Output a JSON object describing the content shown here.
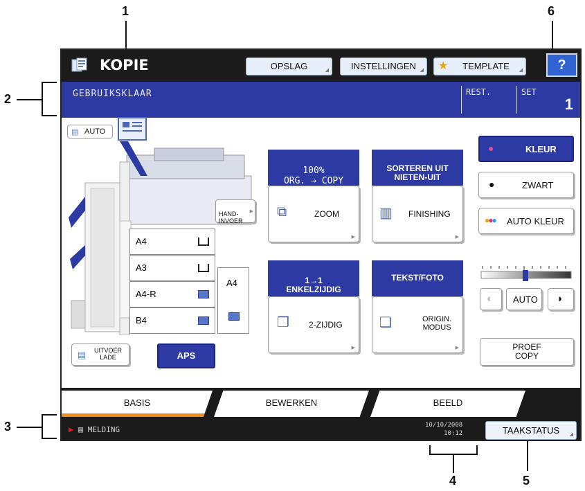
{
  "callouts": {
    "c1": "1",
    "c2": "2",
    "c3": "3",
    "c4": "4",
    "c5": "5",
    "c6": "6"
  },
  "titlebar": {
    "title": "KOPIE",
    "buttons": [
      "OPSLAG",
      "INSTELLINGEN",
      "TEMPLATE"
    ],
    "help": "?"
  },
  "status": {
    "message": "GEBRUIKSKLAAR",
    "rest_label": "REST.",
    "set_label": "SET",
    "set_count": "1"
  },
  "paper": {
    "auto_label": "AUTO",
    "manual_feed": "HAND-\nINVOER",
    "trays": [
      {
        "size": "A4",
        "icon": "open-tray-icon"
      },
      {
        "size": "A3",
        "icon": "open-tray-icon"
      },
      {
        "size": "A4-R",
        "icon": "paper-tray-icon"
      },
      {
        "size": "B4",
        "icon": "paper-tray-icon"
      }
    ],
    "bypass_size": "A4",
    "output_tray": "UITVOER\nLADE",
    "aps": "APS"
  },
  "functions": {
    "zoom_header": "100%\nORG. → COPY",
    "zoom": "ZOOM",
    "finishing_header": "SORTEREN UIT\nNIETEN-UIT",
    "finishing": "FINISHING",
    "duplex_header": "1→1\nENKELZIJDIG",
    "duplex": "2-ZIJDIG",
    "original_header": "TEKST/FOTO",
    "original": "ORIGIN.\nMODUS"
  },
  "color": {
    "kleur": "KLEUR",
    "zwart": "ZWART",
    "auto_kleur": "AUTO KLEUR"
  },
  "density": {
    "auto": "AUTO"
  },
  "proof": "PROEF\nCOPY",
  "tabs": [
    "BASIS",
    "BEWERKEN",
    "BEELD"
  ],
  "footer": {
    "melding": "MELDING",
    "date": "10/10/2008",
    "time": "10:12",
    "taakstatus": "TAAKSTATUS"
  },
  "colors": {
    "accent_blue": "#2d3aa3",
    "active_tab": "#f08a1c",
    "dark_bg": "#1b1b1b"
  }
}
